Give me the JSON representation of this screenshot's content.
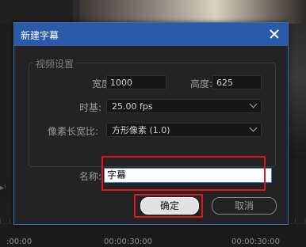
{
  "dialog": {
    "title": "新建字幕",
    "video_settings_label": "视频设置",
    "width_label": "宽度:",
    "width_value": "1000",
    "height_label": "高度:",
    "height_value": "625",
    "timebase_label": "时基:",
    "timebase_value": "25.00 fps",
    "pixel_aspect_label": "像素长宽比:",
    "pixel_aspect_value": "方形像素 (1.0)",
    "name_label": "名称:",
    "name_value": "字幕",
    "ok_label": "确定",
    "cancel_label": "取消"
  },
  "timeline": {
    "times": [
      ":00:00",
      "00:00:30:00",
      "00:00:30:00"
    ]
  },
  "colors": {
    "titlebar": "#2b5aab",
    "highlight": "#e0141e"
  }
}
